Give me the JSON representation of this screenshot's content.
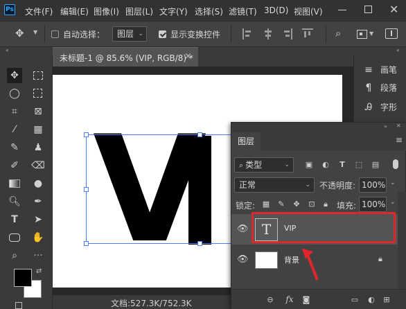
{
  "app": {
    "logo": "Ps"
  },
  "menu": [
    "文件(F)",
    "编辑(E)",
    "图像(I)",
    "图层(L)",
    "文字(Y)",
    "选择(S)",
    "滤镜(T)",
    "3D(D)",
    "视图(V)"
  ],
  "options": {
    "auto_select_label": "自动选择：",
    "auto_select_value": "图层",
    "show_transform_label": "显示变换控件"
  },
  "document": {
    "tab_title": "未标题-1 @ 85.6% (VIP, RGB/8) *",
    "text_content": "VIP",
    "visible_letters": [
      "V",
      "I"
    ]
  },
  "status": {
    "doc_info": "文档:527.3K/752.3K"
  },
  "right_panel": {
    "items": [
      {
        "label": "画笔",
        "icon": "brush-icon"
      },
      {
        "label": "段落",
        "icon": "pilcrow-icon"
      },
      {
        "label": "字形",
        "icon": "glyph-icon"
      }
    ]
  },
  "layers_panel": {
    "title": "图层",
    "filter_kind": "类型",
    "blend_mode": "正常",
    "opacity_label": "不透明度:",
    "opacity_value": "100%",
    "lock_label": "锁定:",
    "fill_label": "填充:",
    "fill_value": "100%",
    "text_layer_glyph": "T",
    "layers": [
      {
        "name": "VIP",
        "type": "text",
        "selected": true
      },
      {
        "name": "背景",
        "type": "background",
        "locked": true
      }
    ],
    "bottom_fx": "fx"
  },
  "colors": {
    "highlight": "#e0262b",
    "selection_handles": "#4a7dff",
    "foreground": "#000000",
    "background": "#ffffff"
  }
}
